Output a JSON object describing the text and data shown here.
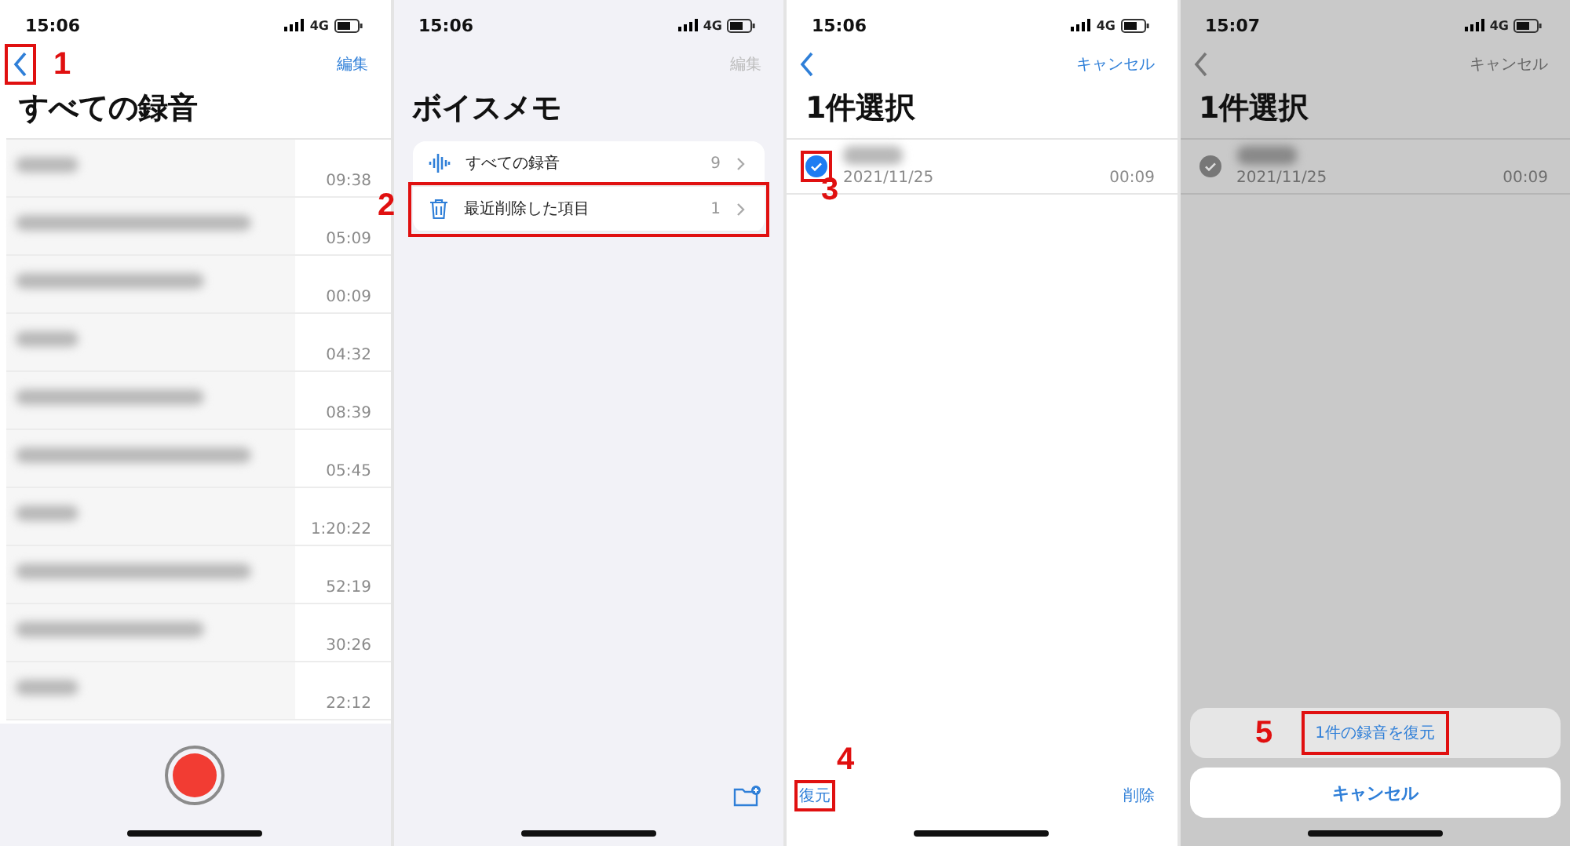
{
  "screen_all_recordings": {
    "status": {
      "time": "15:06",
      "network": "4G"
    },
    "back_step": "1",
    "edit": "編集",
    "title": "すべての録音",
    "rows": [
      {
        "duration": "09:38"
      },
      {
        "duration": "05:09"
      },
      {
        "duration": "00:09"
      },
      {
        "duration": "04:32"
      },
      {
        "duration": "08:39"
      },
      {
        "duration": "05:45"
      },
      {
        "duration": "1:20:22"
      },
      {
        "duration": "52:19"
      },
      {
        "duration": "30:26"
      },
      {
        "duration": "22:12"
      }
    ]
  },
  "screen_voice_memos": {
    "status": {
      "time": "15:06",
      "network": "4G"
    },
    "edit": {
      "label": "編集",
      "disabled": true
    },
    "title": "ボイスメモ",
    "folders": [
      {
        "kind": "waveform",
        "label": "すべての録音",
        "count": "9"
      },
      {
        "kind": "trash",
        "label": "最近削除した項目",
        "count": "1",
        "step": "2"
      }
    ]
  },
  "screen_select": {
    "status": {
      "time": "15:06",
      "network": "4G"
    },
    "cancel": "キャンセル",
    "title": "1件選択",
    "row": {
      "checked": true,
      "date": "2021/11/25",
      "duration": "00:09",
      "step": "3"
    },
    "restore": {
      "label": "復元",
      "step": "4"
    },
    "delete": "削除"
  },
  "screen_restore_sheet": {
    "status": {
      "time": "15:07",
      "network": "4G"
    },
    "cancel": "キャンセル",
    "title": "1件選択",
    "row": {
      "checked": true,
      "date": "2021/11/25",
      "duration": "00:09"
    },
    "sheet": {
      "restore": "1件の録音を復元",
      "step": "5",
      "cancel": "キャンセル"
    }
  }
}
